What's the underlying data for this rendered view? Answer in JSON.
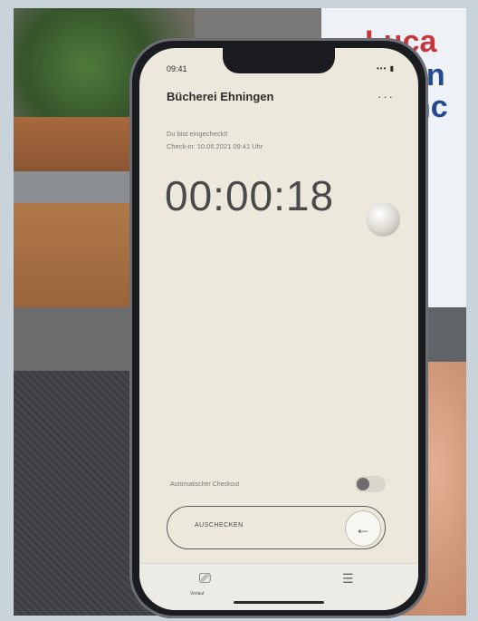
{
  "background": {
    "poster_lines": [
      "Luca",
      "can",
      "nc"
    ]
  },
  "phone": {
    "status": {
      "time": "09:41",
      "icons": "••• ▮"
    },
    "app_title": "Bücherei Ehningen",
    "more_icon": "more-horizontal-icon",
    "checked_in_text": "Du bist eingecheckt!",
    "checkin_time_text": "Check-in: 10.06.2021 09:41 Uhr",
    "timer": "00:00:18",
    "auto_checkout_label": "Automatischer Checkout",
    "auto_checkout_enabled": false,
    "checkout_button_label": "AUSCHECKEN",
    "tabbar": {
      "history_label": "Verlauf",
      "history_icon": "history-icon",
      "menu_icon": "menu-icon"
    },
    "colors": {
      "screen_bg": "#ece9dc",
      "text": "#4a4a4a"
    }
  }
}
